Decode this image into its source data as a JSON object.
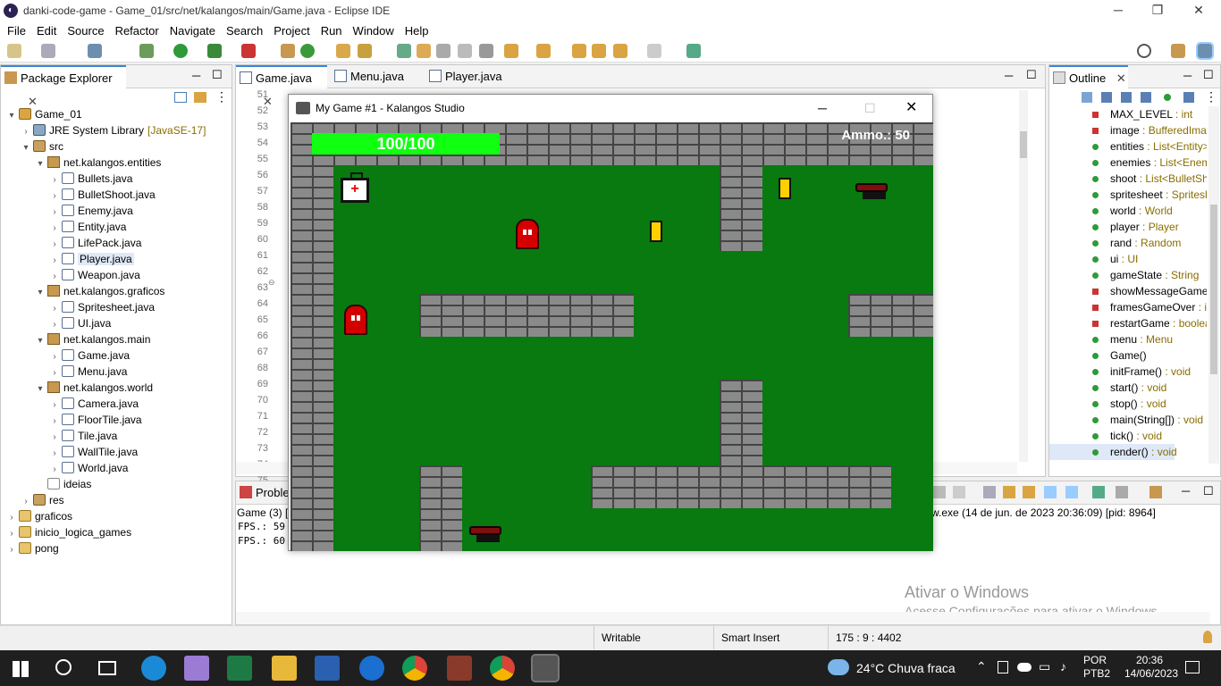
{
  "window": {
    "title": "danki-code-game - Game_01/src/net/kalangos/main/Game.java - Eclipse IDE"
  },
  "menu": [
    "File",
    "Edit",
    "Source",
    "Refactor",
    "Navigate",
    "Search",
    "Project",
    "Run",
    "Window",
    "Help"
  ],
  "explorer": {
    "tab": "Package Explorer",
    "items": [
      {
        "label": "Game_01",
        "indent": 0,
        "arrow": "▾",
        "icon": "proj"
      },
      {
        "label": "JRE System Library",
        "extra": "[JavaSE-17]",
        "indent": 1,
        "arrow": "›",
        "icon": "lib"
      },
      {
        "label": "src",
        "indent": 1,
        "arrow": "▾",
        "icon": "src"
      },
      {
        "label": "net.kalangos.entities",
        "indent": 2,
        "arrow": "▾",
        "icon": "pkg"
      },
      {
        "label": "Bullets.java",
        "indent": 3,
        "arrow": "›",
        "icon": "java"
      },
      {
        "label": "BulletShoot.java",
        "indent": 3,
        "arrow": "›",
        "icon": "java"
      },
      {
        "label": "Enemy.java",
        "indent": 3,
        "arrow": "›",
        "icon": "java"
      },
      {
        "label": "Entity.java",
        "indent": 3,
        "arrow": "›",
        "icon": "java"
      },
      {
        "label": "LifePack.java",
        "indent": 3,
        "arrow": "›",
        "icon": "java"
      },
      {
        "label": "Player.java",
        "indent": 3,
        "arrow": "›",
        "icon": "java",
        "selected": true
      },
      {
        "label": "Weapon.java",
        "indent": 3,
        "arrow": "›",
        "icon": "java"
      },
      {
        "label": "net.kalangos.graficos",
        "indent": 2,
        "arrow": "▾",
        "icon": "pkg"
      },
      {
        "label": "Spritesheet.java",
        "indent": 3,
        "arrow": "›",
        "icon": "java"
      },
      {
        "label": "UI.java",
        "indent": 3,
        "arrow": "›",
        "icon": "java"
      },
      {
        "label": "net.kalangos.main",
        "indent": 2,
        "arrow": "▾",
        "icon": "pkg"
      },
      {
        "label": "Game.java",
        "indent": 3,
        "arrow": "›",
        "icon": "java"
      },
      {
        "label": "Menu.java",
        "indent": 3,
        "arrow": "›",
        "icon": "java"
      },
      {
        "label": "net.kalangos.world",
        "indent": 2,
        "arrow": "▾",
        "icon": "pkg"
      },
      {
        "label": "Camera.java",
        "indent": 3,
        "arrow": "›",
        "icon": "java"
      },
      {
        "label": "FloorTile.java",
        "indent": 3,
        "arrow": "›",
        "icon": "java"
      },
      {
        "label": "Tile.java",
        "indent": 3,
        "arrow": "›",
        "icon": "java"
      },
      {
        "label": "WallTile.java",
        "indent": 3,
        "arrow": "›",
        "icon": "java"
      },
      {
        "label": "World.java",
        "indent": 3,
        "arrow": "›",
        "icon": "java"
      },
      {
        "label": "ideias",
        "indent": 2,
        "arrow": "",
        "icon": "file"
      },
      {
        "label": "res",
        "indent": 1,
        "arrow": "›",
        "icon": "src"
      },
      {
        "label": "graficos",
        "indent": 0,
        "arrow": "›",
        "icon": "fold"
      },
      {
        "label": "inicio_logica_games",
        "indent": 0,
        "arrow": "›",
        "icon": "fold"
      },
      {
        "label": "pong",
        "indent": 0,
        "arrow": "›",
        "icon": "fold"
      }
    ]
  },
  "editor": {
    "tabs": [
      {
        "label": "Game.java",
        "active": true,
        "close": "✕"
      },
      {
        "label": "Menu.java"
      },
      {
        "label": "Player.java"
      }
    ],
    "line_numbers": [
      "51",
      "52",
      "53",
      "54",
      "55",
      "56",
      "57",
      "58",
      "59",
      "60",
      "61",
      "62",
      "63",
      "64",
      "65",
      "66",
      "67",
      "68",
      "69",
      "70",
      "71",
      "72",
      "73",
      "74",
      "75",
      "76",
      "77",
      "78"
    ]
  },
  "outline": {
    "tab": "Outline",
    "items": [
      {
        "name": "MAX_LEVEL",
        "type": " : int",
        "kind": "field-private"
      },
      {
        "name": "image",
        "type": " : BufferedIma",
        "kind": "field-private"
      },
      {
        "name": "entities",
        "type": " : List<Entity>",
        "kind": "field-static"
      },
      {
        "name": "enemies",
        "type": " : List<Enem",
        "kind": "field-static"
      },
      {
        "name": "shoot",
        "type": " : List<BulletSh",
        "kind": "field-static"
      },
      {
        "name": "spritesheet",
        "type": " : Spritesh",
        "kind": "field-static"
      },
      {
        "name": "world",
        "type": " : World",
        "kind": "field-static"
      },
      {
        "name": "player",
        "type": " : Player",
        "kind": "field-static"
      },
      {
        "name": "rand",
        "type": " : Random",
        "kind": "field-static"
      },
      {
        "name": "ui",
        "type": " : UI",
        "kind": "field"
      },
      {
        "name": "gameState",
        "type": " : String",
        "kind": "field-static"
      },
      {
        "name": "showMessageGame",
        "type": "",
        "kind": "field-private"
      },
      {
        "name": "framesGameOver",
        "type": " : i",
        "kind": "field-private"
      },
      {
        "name": "restartGame",
        "type": " : boolea",
        "kind": "field-private"
      },
      {
        "name": "menu",
        "type": " : Menu",
        "kind": "field"
      },
      {
        "name": "Game()",
        "type": "",
        "kind": "method"
      },
      {
        "name": "initFrame()",
        "type": " : void",
        "kind": "method"
      },
      {
        "name": "start()",
        "type": " : void",
        "kind": "method"
      },
      {
        "name": "stop()",
        "type": " : void",
        "kind": "method"
      },
      {
        "name": "main(String[])",
        "type": " : void",
        "kind": "method"
      },
      {
        "name": "tick()",
        "type": " : void",
        "kind": "method"
      },
      {
        "name": "render()",
        "type": " : void",
        "kind": "method",
        "selected": true
      }
    ]
  },
  "console": {
    "tab": "Proble",
    "header_left": "Game (3) [J",
    "header_right": "w.exe  (14 de jun. de 2023 20:36:09) [pid: 8964]",
    "lines": [
      "FPS.: 59",
      "FPS.: 60"
    ]
  },
  "watermark": {
    "line1": "Ativar o Windows",
    "line2": "Acesse Configurações para ativar o Windows."
  },
  "status": {
    "writable": "Writable",
    "insert": "Smart Insert",
    "position": "175 : 9 : 4402"
  },
  "game": {
    "title": "My Game #1 - Kalangos Studio",
    "hp": "100/100",
    "ammo": "Ammo.: 50",
    "medkit_symbol": "+"
  },
  "taskbar": {
    "weather": "24°C  Chuva fraca",
    "lang1": "POR",
    "lang2": "PTB2",
    "time": "20:36",
    "date": "14/06/2023"
  },
  "colors": {
    "floor": "#087a10",
    "hp_bar": "#11ff11",
    "accent": "#3a86d4"
  }
}
